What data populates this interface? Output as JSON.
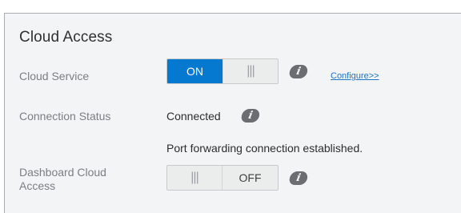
{
  "section": {
    "title": "Cloud Access"
  },
  "cloud_service": {
    "label": "Cloud Service",
    "toggle": {
      "on_label": "ON",
      "handle": "|||",
      "state": "on"
    },
    "info_icon": "info-icon",
    "configure_link": "Configure>>"
  },
  "connection_status": {
    "label": "Connection Status",
    "value": "Connected",
    "info_icon": "info-icon",
    "detail": "Port forwarding connection established."
  },
  "dashboard_cloud_access": {
    "label_line1": "Dashboard Cloud",
    "label_line2": "Access",
    "toggle": {
      "handle": "|||",
      "off_label": "OFF",
      "state": "off"
    },
    "info_icon": "info-icon"
  },
  "colors": {
    "accent": "#0579cf",
    "link": "#1a75c8",
    "panel_bg": "#f3f4f5"
  }
}
